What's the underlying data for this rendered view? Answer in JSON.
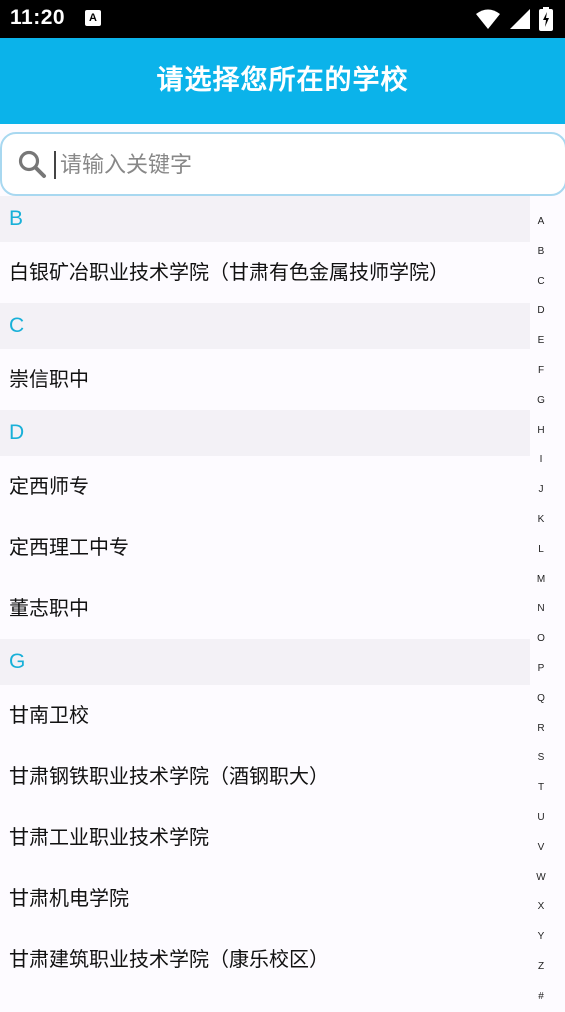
{
  "status_bar": {
    "time": "11:20",
    "notification_icon_letter": "A"
  },
  "header": {
    "title": "请选择您所在的学校"
  },
  "search": {
    "placeholder": "请输入关键字"
  },
  "sections": [
    {
      "letter": "B",
      "items": [
        "白银矿冶职业技术学院（甘肃有色金属技师学院）"
      ]
    },
    {
      "letter": "C",
      "items": [
        "崇信职中"
      ]
    },
    {
      "letter": "D",
      "items": [
        "定西师专",
        "定西理工中专",
        "董志职中"
      ]
    },
    {
      "letter": "G",
      "items": [
        "甘南卫校",
        "甘肃钢铁职业技术学院（酒钢职大）",
        "甘肃工业职业技术学院",
        "甘肃机电学院",
        "甘肃建筑职业技术学院（康乐校区）"
      ]
    }
  ],
  "index_letters": [
    "A",
    "B",
    "C",
    "D",
    "E",
    "F",
    "G",
    "H",
    "I",
    "J",
    "K",
    "L",
    "M",
    "N",
    "O",
    "P",
    "Q",
    "R",
    "S",
    "T",
    "U",
    "V",
    "W",
    "X",
    "Y",
    "Z",
    "#"
  ],
  "colors": {
    "header_bg": "#0bb3ea",
    "section_letter": "#18b0d8",
    "section_bg": "#f3f1f6"
  }
}
